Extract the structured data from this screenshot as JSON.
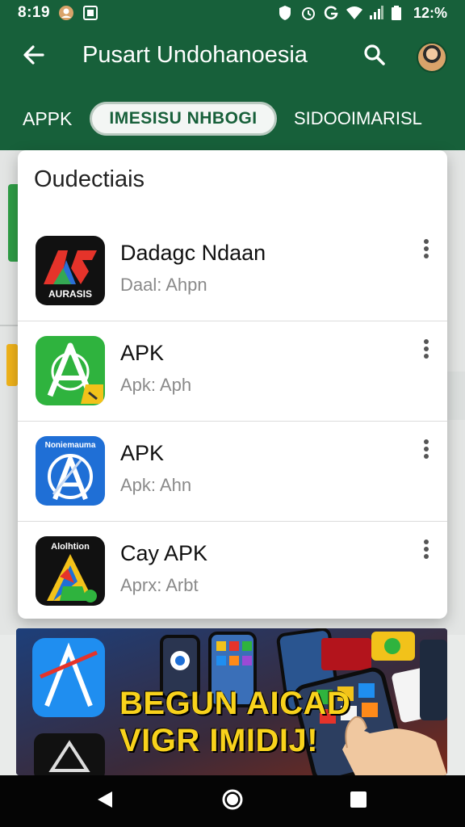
{
  "status_bar": {
    "time": "8:19",
    "battery_percent": "12:%",
    "icons": [
      "account-circle-icon",
      "screenshot-icon",
      "shield-icon",
      "alarm-icon",
      "g-icon",
      "wifi-icon",
      "signal-icon",
      "battery-icon"
    ]
  },
  "app_bar": {
    "title": "Pusart Undohanoesia",
    "back_icon": "arrow-back-icon",
    "search_icon": "search-icon",
    "avatar_icon": "avatar"
  },
  "tabs": [
    {
      "label": "APPK",
      "active": false
    },
    {
      "label": "IMESISU NHBOGI",
      "active": true
    },
    {
      "label": "SIDOOIMARISL",
      "active": false
    }
  ],
  "popup": {
    "title": "Oudectiais",
    "items": [
      {
        "name": "Dadagc Ndaan",
        "subtitle": "Daal: Ahpn",
        "icon": "ac-logo-icon",
        "icon_text": "AURASIS"
      },
      {
        "name": "APK",
        "subtitle": "Apk: Aph",
        "icon": "green-a-icon"
      },
      {
        "name": "APK",
        "subtitle": "Apk: Ahn",
        "icon": "blue-a-icon",
        "icon_text": "Noniemauma"
      },
      {
        "name": "Cay APK",
        "subtitle": "Aprx: Arbt",
        "icon": "colorful-a-icon",
        "icon_text": "Alolhtion"
      }
    ]
  },
  "banner": {
    "headline_line1": "BEGUN AICAD",
    "headline_line2": "VIGR IMIDIJ!",
    "colors": {
      "text": "#f8d21c",
      "bg": "#1a2a4a"
    }
  },
  "nav_bar": {
    "back_icon": "nav-back-icon",
    "home_icon": "nav-home-icon",
    "recents_icon": "nav-recents-icon"
  },
  "colors": {
    "primary": "#17603a",
    "popup_bg": "#ffffff",
    "subtitle": "#8a8a8a"
  }
}
